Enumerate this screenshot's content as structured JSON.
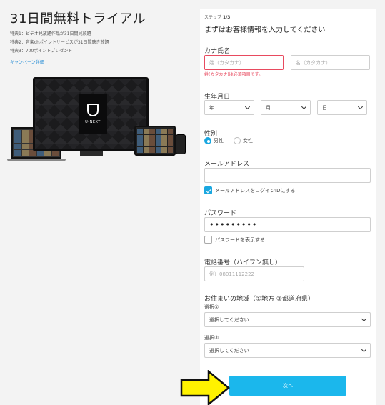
{
  "promo": {
    "title": "31日間無料トライアル",
    "perks": [
      "特典1：ビデオ見放題作品が31日間見放題",
      "特典2：音楽chポイントサービスが31日間聴き放題",
      "特典3：700ポイントプレゼント"
    ],
    "campaign_link": "キャンペーン詳細",
    "tv_brand": "U-NEXT"
  },
  "form": {
    "step_prefix": "ステップ",
    "step_value": "1/3",
    "headline": "まずはお客様情報を入力してください",
    "kana_label": "カナ氏名",
    "last_kana_placeholder": "姓（カタカナ）",
    "first_kana_placeholder": "名（カタカナ）",
    "kana_error": "姓(カタカナ)は必須項目です。",
    "birth_label": "生年月日",
    "birth_year": "年",
    "birth_month": "月",
    "birth_day": "日",
    "gender_label": "性別",
    "gender_male": "男性",
    "gender_female": "女性",
    "email_label": "メールアドレス",
    "email_value": "",
    "email_as_login_label": "メールアドレスをログインIDにする",
    "password_label": "パスワード",
    "password_value": "•••••••••",
    "show_password_label": "パスワードを表示する",
    "phone_label": "電話番号（ハイフン無し）",
    "phone_placeholder": "例）08011112222",
    "region_label": "お住まいの地域（①地方 ②都道府県）",
    "region1_label": "選択①",
    "region1_value": "選択してください",
    "region2_label": "選択②",
    "region2_value": "選択してください",
    "next_label": "次へ"
  },
  "colors": {
    "accent": "#1bb7ec",
    "error": "#e84a5f",
    "arrow": "#fff200"
  }
}
